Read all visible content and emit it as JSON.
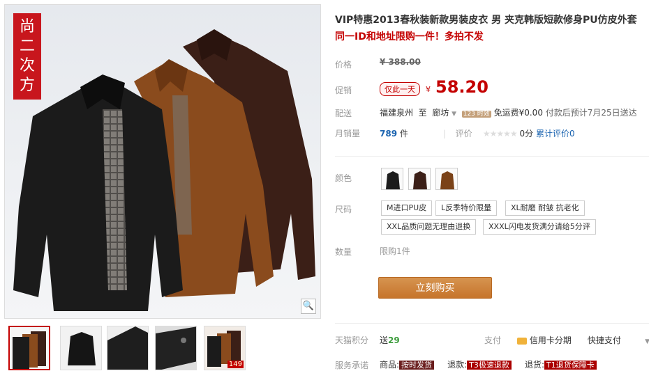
{
  "product": {
    "title": "VIP特惠2013春秋装新款男装皮衣 男 夹克韩版短款修身PU仿皮外套",
    "subtitle": "同一ID和地址限购一件！多拍不发",
    "banner_text": [
      "尚",
      "二",
      "次",
      "方"
    ]
  },
  "price": {
    "label": "价格",
    "currency": "¥",
    "original": "388.00",
    "promo_label": "促销",
    "promo_tag": "仅此一天",
    "promo_price": "58.20"
  },
  "shipping": {
    "label": "配送",
    "from": "福建泉州",
    "to_word": "至",
    "to": "廊坊",
    "time_badge": "123 时效",
    "fee": "免运费¥0.00",
    "eta": "付款后预计7月25日送达"
  },
  "sales": {
    "label": "月销量",
    "count": "789",
    "count_unit": "件",
    "review_label": "评价",
    "stars": "★★★★★",
    "score": "0分",
    "review_count": "累计评价0"
  },
  "color": {
    "label": "颜色",
    "options": [
      "black",
      "brown",
      "brown-light"
    ]
  },
  "size": {
    "label": "尺码",
    "options": [
      "M进口PU皮",
      "L反季特价限量",
      "XL耐磨 耐皱 抗老化",
      "XXL品质问题无理由退换",
      "XXXL闪电发货满分请给5分评"
    ]
  },
  "quantity": {
    "label": "数量",
    "note": "限购1件"
  },
  "buy_button": "立刻购买",
  "points": {
    "label": "天猫积分",
    "prefix": "送",
    "value": "29",
    "pay_label": "支付",
    "credit": "信用卡分期",
    "quick": "快捷支付"
  },
  "services": {
    "label": "服务承诺",
    "goods": "商品:",
    "goods_tag": "按时发货",
    "refund": "退款:",
    "refund_tag": "T3极速退款",
    "return": "退货:",
    "return_tag": "T1退货保障卡"
  },
  "thumb_badge": "149",
  "colors": {
    "accent": "#c40000",
    "buy_button": "#c6742b",
    "banner": "#c8161d",
    "link": "#1b64b0"
  }
}
